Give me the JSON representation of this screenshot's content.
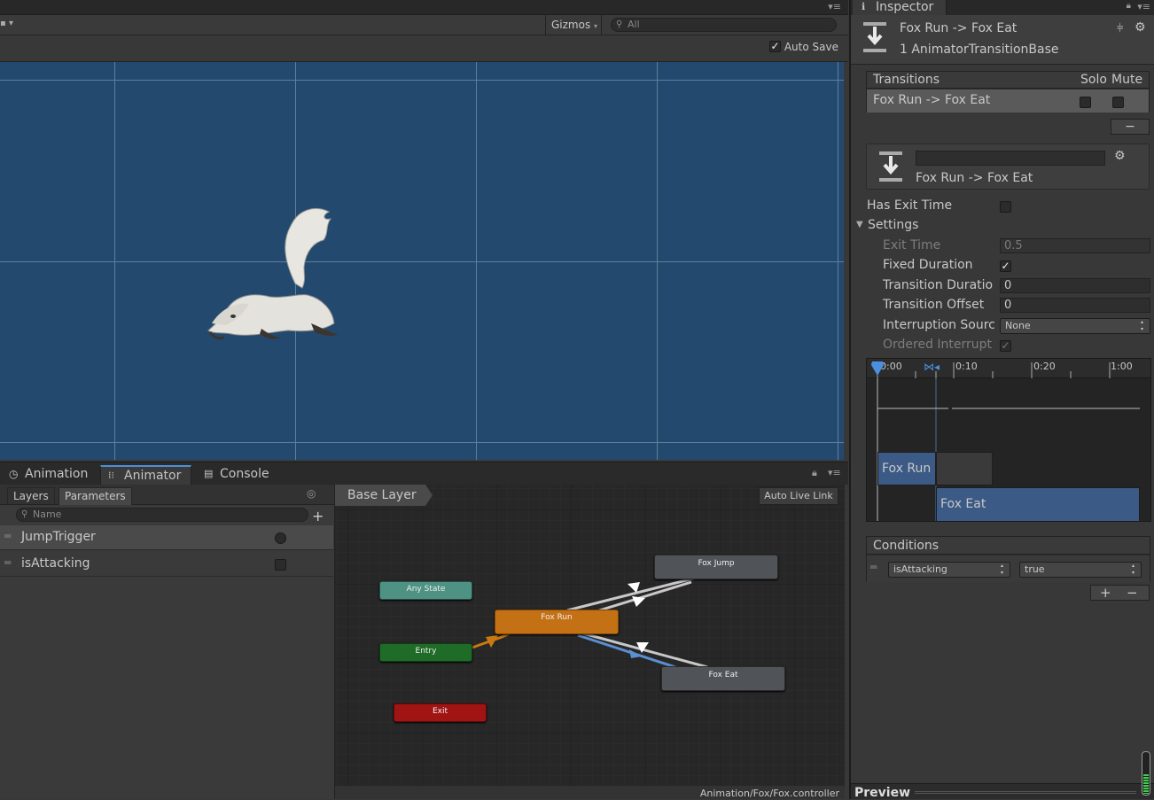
{
  "scene": {
    "gizmos_label": "Gizmos",
    "search_placeholder": "All",
    "auto_save_label": "Auto Save",
    "auto_save_checked": true
  },
  "bottom_tabs": [
    {
      "label": "Animation",
      "icon": "clock-icon",
      "active": false
    },
    {
      "label": "Animator",
      "icon": "animator-icon",
      "active": true
    },
    {
      "label": "Console",
      "icon": "console-icon",
      "active": false
    }
  ],
  "params_panel": {
    "tab_layers": "Layers",
    "tab_parameters": "Parameters",
    "search_placeholder": "Name",
    "parameters": [
      {
        "name": "JumpTrigger",
        "type": "trigger"
      },
      {
        "name": "isAttacking",
        "type": "bool"
      }
    ]
  },
  "graph": {
    "breadcrumb": "Base Layer",
    "auto_live_link": "Auto Live Link",
    "footer_path": "Animation/Fox/Fox.controller",
    "nodes": {
      "fox_jump": "Fox Jump",
      "any_state": "Any State",
      "fox_run": "Fox Run",
      "entry": "Entry",
      "fox_eat": "Fox Eat",
      "exit": "Exit"
    }
  },
  "inspector": {
    "tab": "Inspector",
    "title": "Fox Run -> Fox Eat",
    "subtitle": "1 AnimatorTransitionBase",
    "transitions_header": "Transitions",
    "solo_label": "Solo",
    "mute_label": "Mute",
    "transitions": [
      {
        "name": "Fox Run -> Fox Eat"
      }
    ],
    "transition_name": "Fox Run -> Fox Eat",
    "has_exit_time_label": "Has Exit Time",
    "settings_label": "Settings",
    "exit_time_label": "Exit Time",
    "exit_time_value": "0.5",
    "fixed_duration_label": "Fixed Duration",
    "transition_duration_label": "Transition Duratio",
    "transition_duration_value": "0",
    "transition_offset_label": "Transition Offset",
    "transition_offset_value": "0",
    "interruption_source_label": "Interruption Sourc",
    "interruption_source_value": "None",
    "ordered_interrupt_label": "Ordered Interrupt",
    "timeline_ticks": [
      "0:00",
      "0:10",
      "0:20",
      "1:00"
    ],
    "timeline_from": "Fox Run",
    "timeline_to": "Fox Eat",
    "conditions_label": "Conditions",
    "condition_param": "isAttacking",
    "condition_value": "true",
    "preview_label": "Preview"
  }
}
